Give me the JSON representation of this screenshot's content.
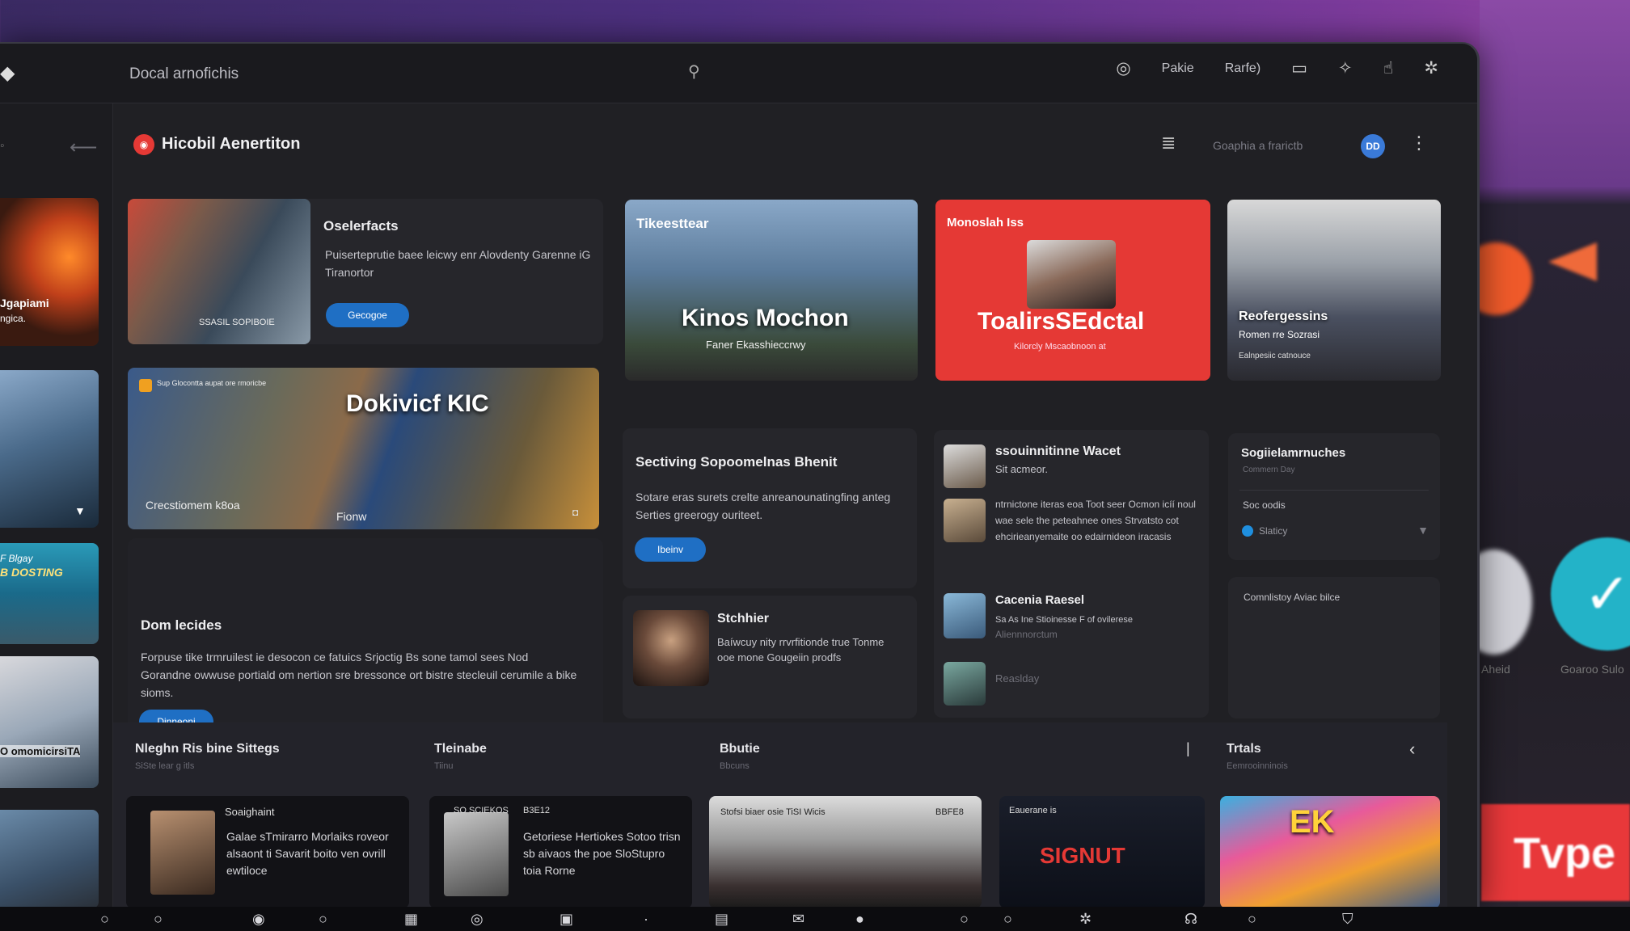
{
  "window": {
    "title": "Docal arnofichis"
  },
  "topbar": {
    "right_text_1": "Pakie",
    "right_text_2": "Rarfe)"
  },
  "app": {
    "title": "Hicobil Aenertiton",
    "search_placeholder": "Goaphia a frarictb",
    "avatar_initials": "DD"
  },
  "rail": {
    "caption_1": "Jgapiami",
    "caption_1b": "ngica.",
    "caption_3a": "F Blgay",
    "caption_3b": "B DOSTING",
    "caption_4": "O omomicirsiTA"
  },
  "feature_card": {
    "title": "Oselerfacts",
    "description": "Puiserteprutie baee leicwy enr Alovdenty Garenne iG Tiranortor",
    "button": "Gecogoe",
    "image_caption": "SSASIL SOPIBOIE"
  },
  "hero_banner": {
    "title": "Dokivicf KIC",
    "badge": "Sup Glocontta aupat ore rmoricbe",
    "caption_left": "Crecstiomem k8oa",
    "caption_right": "Fionw"
  },
  "downloads_card": {
    "title": "Dom lecides",
    "description": "Forpuse tike trmruilest ie desocon ce fatuics Srjoctig Bs sone tamol sees Nod Gorandne owwuse portiald om nertion sre bressonce ort bistre stecleuil cerumile a bike sioms.",
    "button": "Dinneoni"
  },
  "movie_card_1": {
    "label": "Tikeesttear",
    "title": "Kinos Mochon",
    "subtitle": "Faner Ekasshieccrwy"
  },
  "sectioning_card": {
    "title": "Sectiving Sopoomelnas Bhenit",
    "description": "Sotare eras surets crelte anreanounatingfing anteg Serties greerogy ouriteet.",
    "button": "Ibeinv"
  },
  "profile_card": {
    "title": "Stchhier",
    "description": "Baíwcuy nity rrvrfitionde true Tonme ooe mone Gougeiin prodfs"
  },
  "red_card": {
    "label": "Monoslah Iss",
    "title": "ToalirsSEdctal",
    "subtitle": "Kilorcly Mscaobnoon at"
  },
  "people_list": {
    "items": [
      {
        "name": "ssouinnitinne Wacet",
        "meta": "Sit acmeor.",
        "text": ""
      },
      {
        "name": "",
        "meta": "",
        "text": "ntrnictone iteras eoa Toot seer Ocmon icíí noul wae sele the peteahnee ones Strvatsto cot ehcirieanyemaite oo edairnideon iracasis"
      },
      {
        "name": "Cacenia Raesel",
        "meta": "Sa As Ine Stioinesse F of ovilerese",
        "text": "Aliennnorctum"
      },
      {
        "name": "",
        "meta": "",
        "text": "Reaslday"
      }
    ]
  },
  "side_card": {
    "title": "Sogiielamrnuches",
    "subtitle": "Commern Day",
    "row_label": "Soc oodis",
    "status": "Slaticy",
    "footer": "Comnlistoy Aviac bilce"
  },
  "movie_card_4": {
    "title": "Reofergessins",
    "subtitle": "Romen rre Sozrasi",
    "caption": "Ealnpesiic catnouce"
  },
  "bottom": {
    "col1": {
      "title": "Nleghn Ris bine Sittegs",
      "sub": "SiSte lear g itls"
    },
    "col2": {
      "title": "Tleinabe",
      "sub": "Tiinu"
    },
    "col3": {
      "title": "Bbutie",
      "sub": "Bbcuns"
    },
    "col4": {
      "title": "Trtals",
      "sub": "Eemrooinninois"
    },
    "cards": [
      {
        "label": "Soaighaint",
        "text": "Galae sTmirarro Morlaiks roveor alsaont ti Savarit boito ven ovrill ewtiloce"
      },
      {
        "label": "SO SCIEKOS",
        "label2": "B3E12",
        "text": "Getoriese Hertiokes Sotoo trisn sb aivaos the poe SloStupro toia Rorne"
      },
      {
        "label": "Stofsi biaer osie TiSI Wicis",
        "label2": "BBFE8"
      },
      {
        "label": "Eauerane is",
        "title": "SIGNUT"
      },
      {
        "title": "EK"
      }
    ]
  },
  "backdrop": {
    "label_a": "Aheid",
    "label_b": "Goaroo Sulo",
    "red_text": "Tvpe"
  },
  "colors": {
    "accent_blue": "#1f6fc4",
    "red_card": "#e53935",
    "window_bg": "#202024"
  }
}
